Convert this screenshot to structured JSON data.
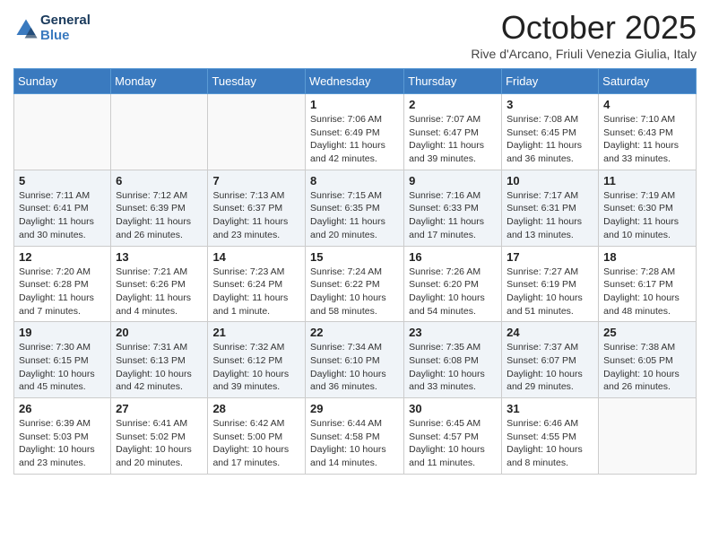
{
  "header": {
    "logo_line1": "General",
    "logo_line2": "Blue",
    "month_title": "October 2025",
    "location": "Rive d'Arcano, Friuli Venezia Giulia, Italy"
  },
  "weekdays": [
    "Sunday",
    "Monday",
    "Tuesday",
    "Wednesday",
    "Thursday",
    "Friday",
    "Saturday"
  ],
  "weeks": [
    [
      {
        "day": "",
        "info": ""
      },
      {
        "day": "",
        "info": ""
      },
      {
        "day": "",
        "info": ""
      },
      {
        "day": "1",
        "info": "Sunrise: 7:06 AM\nSunset: 6:49 PM\nDaylight: 11 hours and 42 minutes."
      },
      {
        "day": "2",
        "info": "Sunrise: 7:07 AM\nSunset: 6:47 PM\nDaylight: 11 hours and 39 minutes."
      },
      {
        "day": "3",
        "info": "Sunrise: 7:08 AM\nSunset: 6:45 PM\nDaylight: 11 hours and 36 minutes."
      },
      {
        "day": "4",
        "info": "Sunrise: 7:10 AM\nSunset: 6:43 PM\nDaylight: 11 hours and 33 minutes."
      }
    ],
    [
      {
        "day": "5",
        "info": "Sunrise: 7:11 AM\nSunset: 6:41 PM\nDaylight: 11 hours and 30 minutes."
      },
      {
        "day": "6",
        "info": "Sunrise: 7:12 AM\nSunset: 6:39 PM\nDaylight: 11 hours and 26 minutes."
      },
      {
        "day": "7",
        "info": "Sunrise: 7:13 AM\nSunset: 6:37 PM\nDaylight: 11 hours and 23 minutes."
      },
      {
        "day": "8",
        "info": "Sunrise: 7:15 AM\nSunset: 6:35 PM\nDaylight: 11 hours and 20 minutes."
      },
      {
        "day": "9",
        "info": "Sunrise: 7:16 AM\nSunset: 6:33 PM\nDaylight: 11 hours and 17 minutes."
      },
      {
        "day": "10",
        "info": "Sunrise: 7:17 AM\nSunset: 6:31 PM\nDaylight: 11 hours and 13 minutes."
      },
      {
        "day": "11",
        "info": "Sunrise: 7:19 AM\nSunset: 6:30 PM\nDaylight: 11 hours and 10 minutes."
      }
    ],
    [
      {
        "day": "12",
        "info": "Sunrise: 7:20 AM\nSunset: 6:28 PM\nDaylight: 11 hours and 7 minutes."
      },
      {
        "day": "13",
        "info": "Sunrise: 7:21 AM\nSunset: 6:26 PM\nDaylight: 11 hours and 4 minutes."
      },
      {
        "day": "14",
        "info": "Sunrise: 7:23 AM\nSunset: 6:24 PM\nDaylight: 11 hours and 1 minute."
      },
      {
        "day": "15",
        "info": "Sunrise: 7:24 AM\nSunset: 6:22 PM\nDaylight: 10 hours and 58 minutes."
      },
      {
        "day": "16",
        "info": "Sunrise: 7:26 AM\nSunset: 6:20 PM\nDaylight: 10 hours and 54 minutes."
      },
      {
        "day": "17",
        "info": "Sunrise: 7:27 AM\nSunset: 6:19 PM\nDaylight: 10 hours and 51 minutes."
      },
      {
        "day": "18",
        "info": "Sunrise: 7:28 AM\nSunset: 6:17 PM\nDaylight: 10 hours and 48 minutes."
      }
    ],
    [
      {
        "day": "19",
        "info": "Sunrise: 7:30 AM\nSunset: 6:15 PM\nDaylight: 10 hours and 45 minutes."
      },
      {
        "day": "20",
        "info": "Sunrise: 7:31 AM\nSunset: 6:13 PM\nDaylight: 10 hours and 42 minutes."
      },
      {
        "day": "21",
        "info": "Sunrise: 7:32 AM\nSunset: 6:12 PM\nDaylight: 10 hours and 39 minutes."
      },
      {
        "day": "22",
        "info": "Sunrise: 7:34 AM\nSunset: 6:10 PM\nDaylight: 10 hours and 36 minutes."
      },
      {
        "day": "23",
        "info": "Sunrise: 7:35 AM\nSunset: 6:08 PM\nDaylight: 10 hours and 33 minutes."
      },
      {
        "day": "24",
        "info": "Sunrise: 7:37 AM\nSunset: 6:07 PM\nDaylight: 10 hours and 29 minutes."
      },
      {
        "day": "25",
        "info": "Sunrise: 7:38 AM\nSunset: 6:05 PM\nDaylight: 10 hours and 26 minutes."
      }
    ],
    [
      {
        "day": "26",
        "info": "Sunrise: 6:39 AM\nSunset: 5:03 PM\nDaylight: 10 hours and 23 minutes."
      },
      {
        "day": "27",
        "info": "Sunrise: 6:41 AM\nSunset: 5:02 PM\nDaylight: 10 hours and 20 minutes."
      },
      {
        "day": "28",
        "info": "Sunrise: 6:42 AM\nSunset: 5:00 PM\nDaylight: 10 hours and 17 minutes."
      },
      {
        "day": "29",
        "info": "Sunrise: 6:44 AM\nSunset: 4:58 PM\nDaylight: 10 hours and 14 minutes."
      },
      {
        "day": "30",
        "info": "Sunrise: 6:45 AM\nSunset: 4:57 PM\nDaylight: 10 hours and 11 minutes."
      },
      {
        "day": "31",
        "info": "Sunrise: 6:46 AM\nSunset: 4:55 PM\nDaylight: 10 hours and 8 minutes."
      },
      {
        "day": "",
        "info": ""
      }
    ]
  ]
}
